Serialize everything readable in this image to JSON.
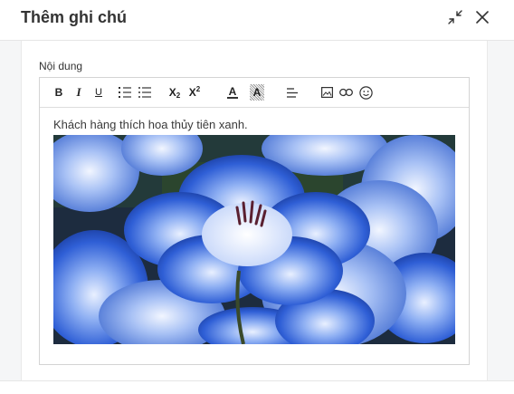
{
  "dialog": {
    "title": "Thêm ghi chú",
    "minimize_icon": "collapse-arrows-icon",
    "close_icon": "close-icon"
  },
  "form": {
    "content_label": "Nội dung"
  },
  "toolbar": {
    "buttons": [
      {
        "name": "bold",
        "icon": "bold-icon",
        "glyph": "B"
      },
      {
        "name": "italic",
        "icon": "italic-icon",
        "glyph": "I"
      },
      {
        "name": "underline",
        "icon": "underline-icon",
        "glyph": "U"
      },
      {
        "name": "ordered-list",
        "icon": "ordered-list-icon"
      },
      {
        "name": "bullet-list",
        "icon": "bullet-list-icon"
      },
      {
        "name": "subscript",
        "icon": "subscript-icon",
        "glyph": "X",
        "sub": "2"
      },
      {
        "name": "superscript",
        "icon": "superscript-icon",
        "glyph": "X",
        "sup": "2"
      },
      {
        "name": "font-color",
        "icon": "font-color-icon",
        "glyph": "A"
      },
      {
        "name": "background-color",
        "icon": "highlight-icon",
        "glyph": "A"
      },
      {
        "name": "align",
        "icon": "align-left-icon"
      },
      {
        "name": "image",
        "icon": "image-icon"
      },
      {
        "name": "link",
        "icon": "link-icon"
      },
      {
        "name": "emoji",
        "icon": "emoji-icon"
      }
    ]
  },
  "editor": {
    "text": "Khách hàng thích hoa thủy tiên xanh.",
    "image_subject": "blue-flowers-photo"
  },
  "colors": {
    "flower_blue": "#2f5fd6",
    "border": "#d4d4d4",
    "background": "#f5f6f7"
  }
}
